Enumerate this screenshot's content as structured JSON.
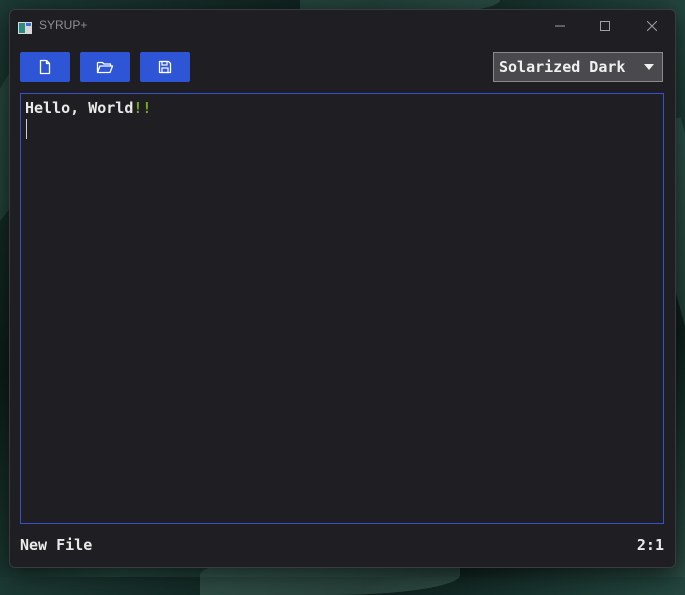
{
  "window": {
    "title": "SYRUP+"
  },
  "toolbar": {
    "new_icon": "new-file-icon",
    "open_icon": "open-folder-icon",
    "save_icon": "save-floppy-icon",
    "theme_selected": "Solarized Dark"
  },
  "editor": {
    "text_main": "Hello, World",
    "text_accent": "!!"
  },
  "status": {
    "file_name": "New File",
    "cursor_position": "2:1"
  },
  "colors": {
    "button_blue": "#2d55d6",
    "editor_border": "#3552cc",
    "accent_green": "#78a820",
    "window_bg": "#1f1f23"
  }
}
